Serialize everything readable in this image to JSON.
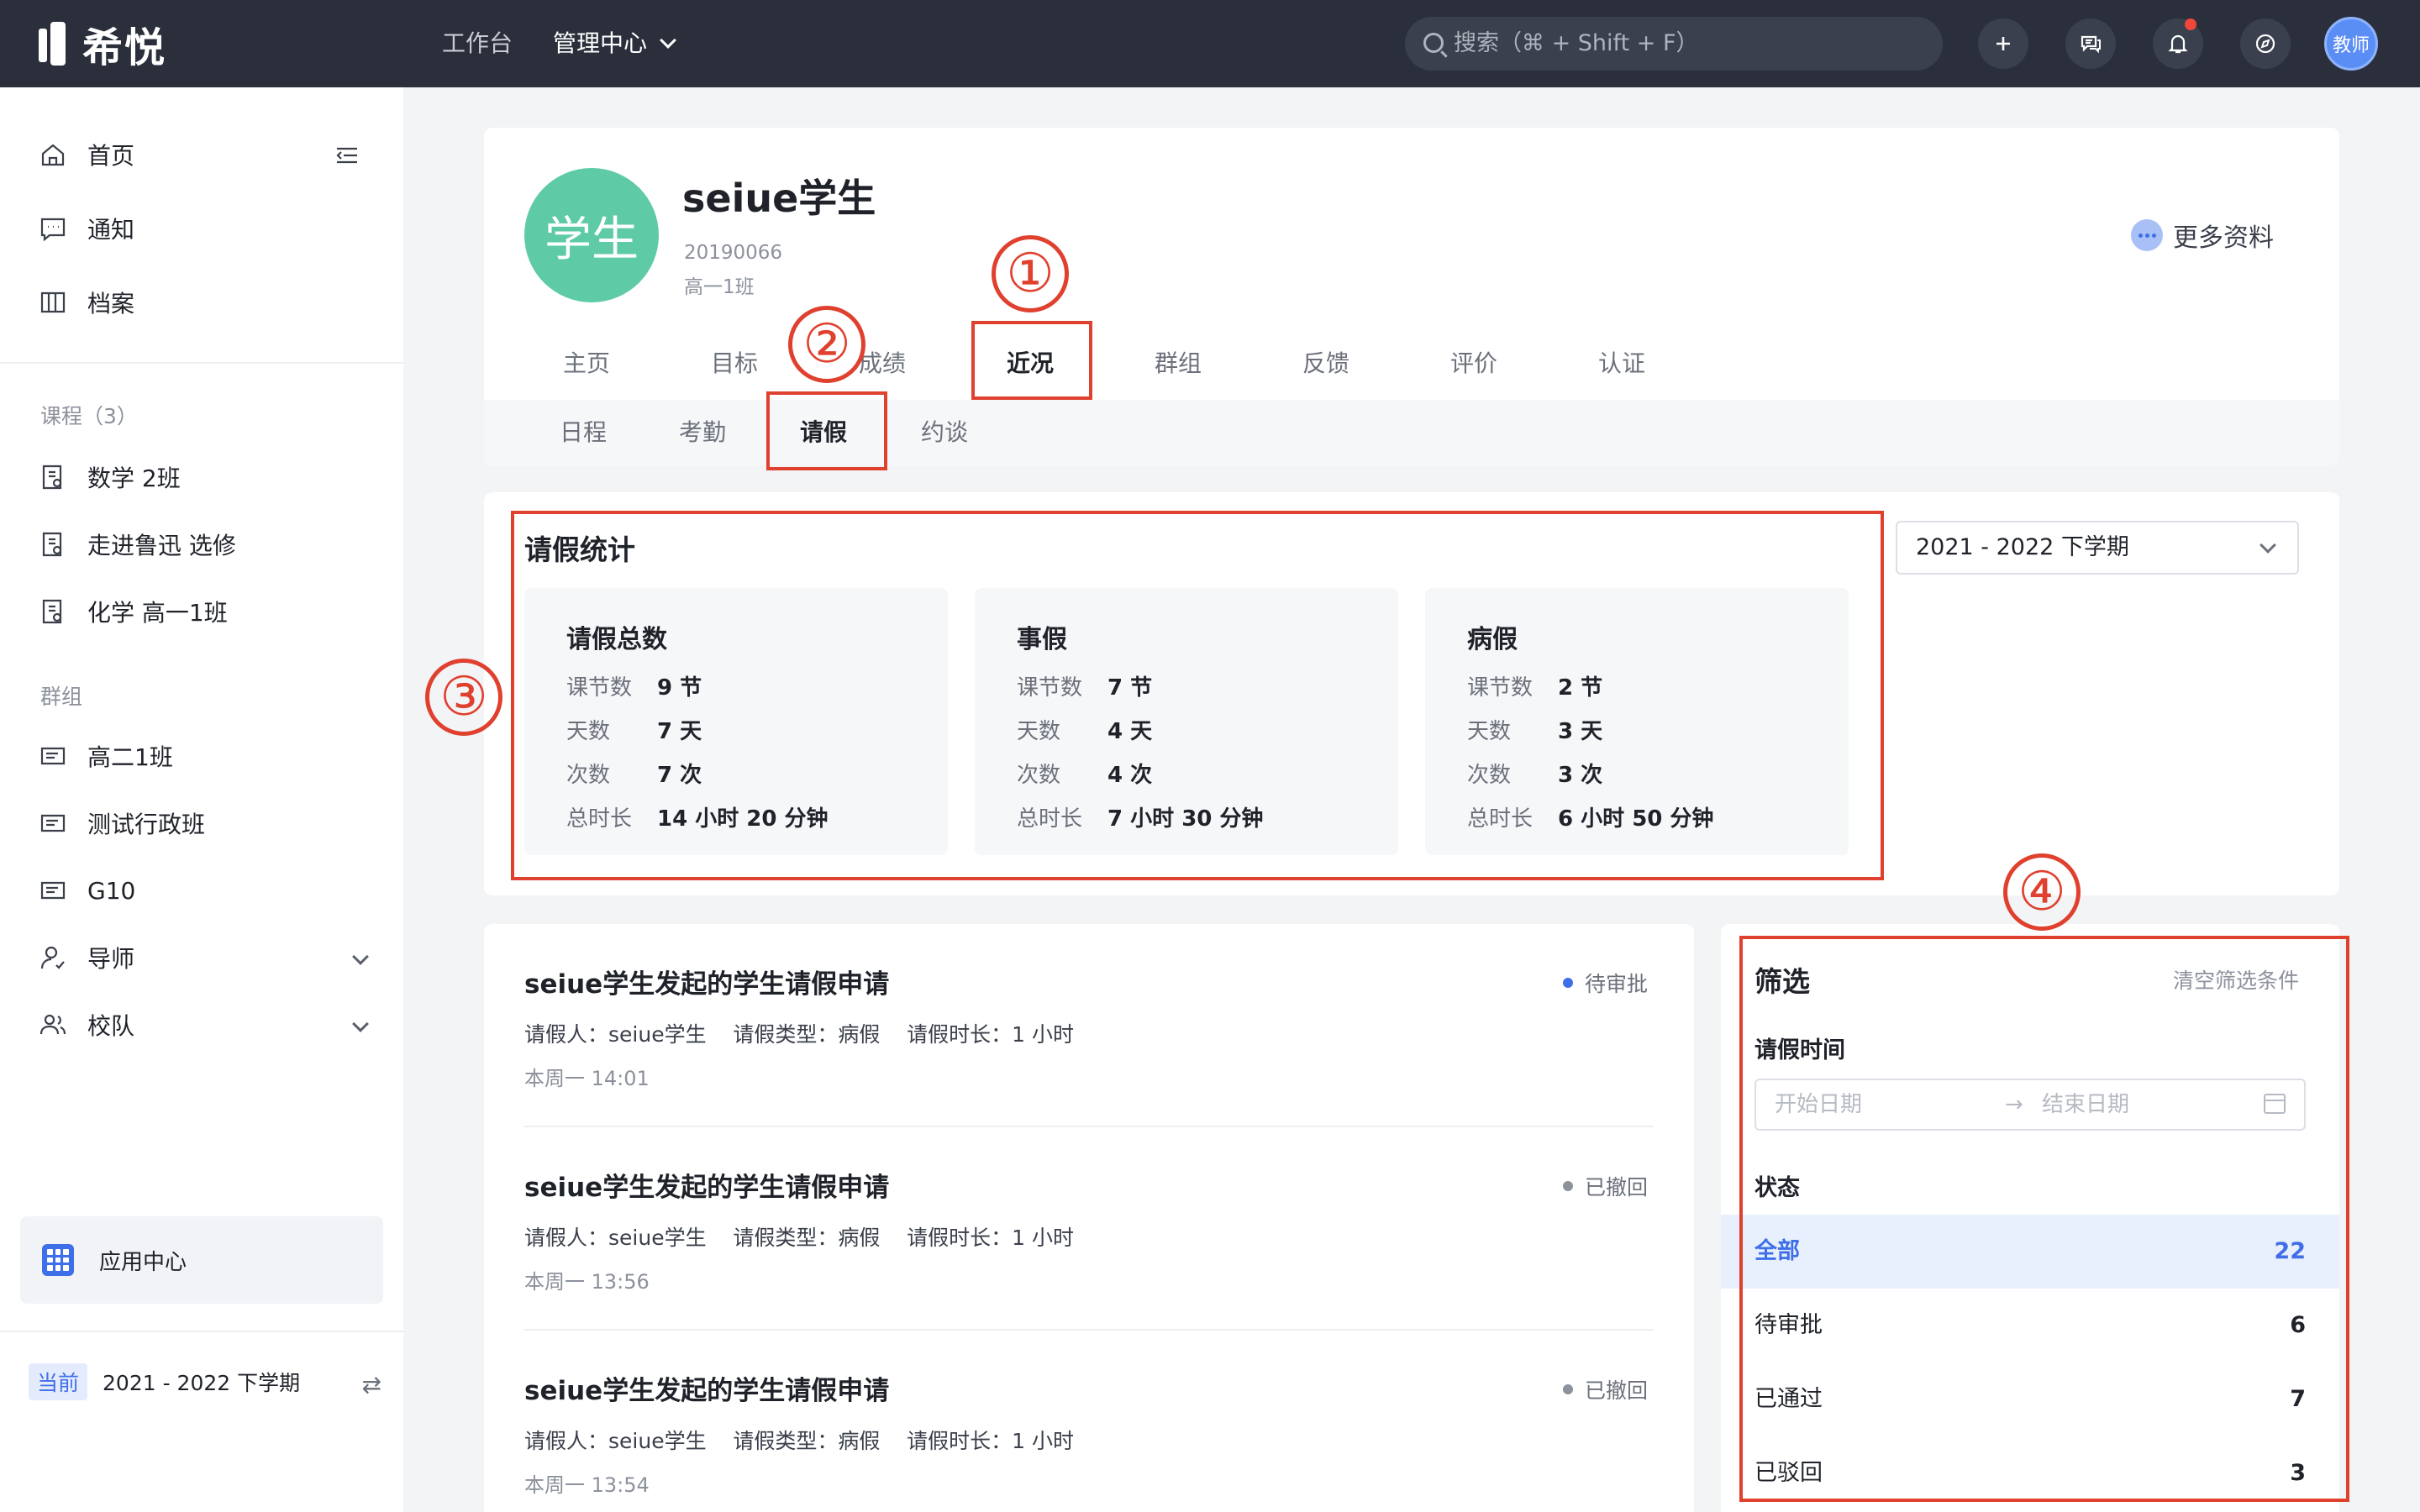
{
  "topbar": {
    "logo": "希悦",
    "nav": [
      {
        "label": "工作台"
      },
      {
        "label": "管理中心"
      }
    ],
    "search_placeholder": "搜索（⌘ + Shift + F）",
    "avatar": "教师"
  },
  "sidebar": {
    "main": [
      {
        "label": "首页"
      },
      {
        "label": "通知"
      },
      {
        "label": "档案"
      }
    ],
    "courses_title": "课程（3）",
    "courses": [
      {
        "label": "数学 2班"
      },
      {
        "label": "走进鲁迅 选修"
      },
      {
        "label": "化学 高一1班"
      }
    ],
    "groups_title": "群组",
    "groups": [
      {
        "label": "高二1班"
      },
      {
        "label": "测试行政班"
      },
      {
        "label": "G10"
      },
      {
        "label": "导师"
      },
      {
        "label": "校队"
      }
    ],
    "app_center": "应用中心",
    "term_tag": "当前",
    "term": "2021 - 2022 下学期"
  },
  "profile": {
    "avatar": "学生",
    "name": "seiue学生",
    "id": "20190066",
    "class": "高一1班",
    "more": "更多资料",
    "tabs": [
      "主页",
      "目标",
      "成绩",
      "近况",
      "群组",
      "反馈",
      "评价",
      "认证"
    ],
    "subtabs": [
      "日程",
      "考勤",
      "请假",
      "约谈"
    ]
  },
  "stats": {
    "title": "请假统计",
    "term_select": "2021 - 2022 下学期",
    "boxes": [
      {
        "title": "请假总数",
        "rows": [
          {
            "k": "课节数",
            "v": "9 节"
          },
          {
            "k": "天数",
            "v": "7 天"
          },
          {
            "k": "次数",
            "v": "7 次"
          },
          {
            "k": "总时长",
            "v": "14 小时 20 分钟"
          }
        ]
      },
      {
        "title": "事假",
        "rows": [
          {
            "k": "课节数",
            "v": "7 节"
          },
          {
            "k": "天数",
            "v": "4 天"
          },
          {
            "k": "次数",
            "v": "4 次"
          },
          {
            "k": "总时长",
            "v": "7 小时 30 分钟"
          }
        ]
      },
      {
        "title": "病假",
        "rows": [
          {
            "k": "课节数",
            "v": "2 节"
          },
          {
            "k": "天数",
            "v": "3 天"
          },
          {
            "k": "次数",
            "v": "3 次"
          },
          {
            "k": "总时长",
            "v": "6 小时 50 分钟"
          }
        ]
      }
    ]
  },
  "list": [
    {
      "title": "seiue学生发起的学生请假申请",
      "meta": "请假人：seiue学生    请假类型：病假    请假时长：1 小时",
      "time": "本周一 14:01",
      "status": "待审批"
    },
    {
      "title": "seiue学生发起的学生请假申请",
      "meta": "请假人：seiue学生    请假类型：病假    请假时长：1 小时",
      "time": "本周一 13:56",
      "status": "已撤回"
    },
    {
      "title": "seiue学生发起的学生请假申请",
      "meta": "请假人：seiue学生    请假类型：病假    请假时长：1 小时",
      "time": "本周一 13:54",
      "status": "已撤回"
    }
  ],
  "filter": {
    "title": "筛选",
    "clear": "清空筛选条件",
    "time_label": "请假时间",
    "start_placeholder": "开始日期",
    "arrow": "→",
    "end_placeholder": "结束日期",
    "status_label": "状态",
    "options": [
      {
        "name": "全部",
        "count": "22"
      },
      {
        "name": "待审批",
        "count": "6"
      },
      {
        "name": "已通过",
        "count": "7"
      },
      {
        "name": "已驳回",
        "count": "3"
      }
    ]
  },
  "annotations": [
    "①",
    "②",
    "③",
    "④"
  ],
  "colors": {
    "accent": "#3f6fe8",
    "annotation": "#e0402e",
    "avatar_green": "#5ecba6",
    "topbar": "#2a2f3b"
  }
}
